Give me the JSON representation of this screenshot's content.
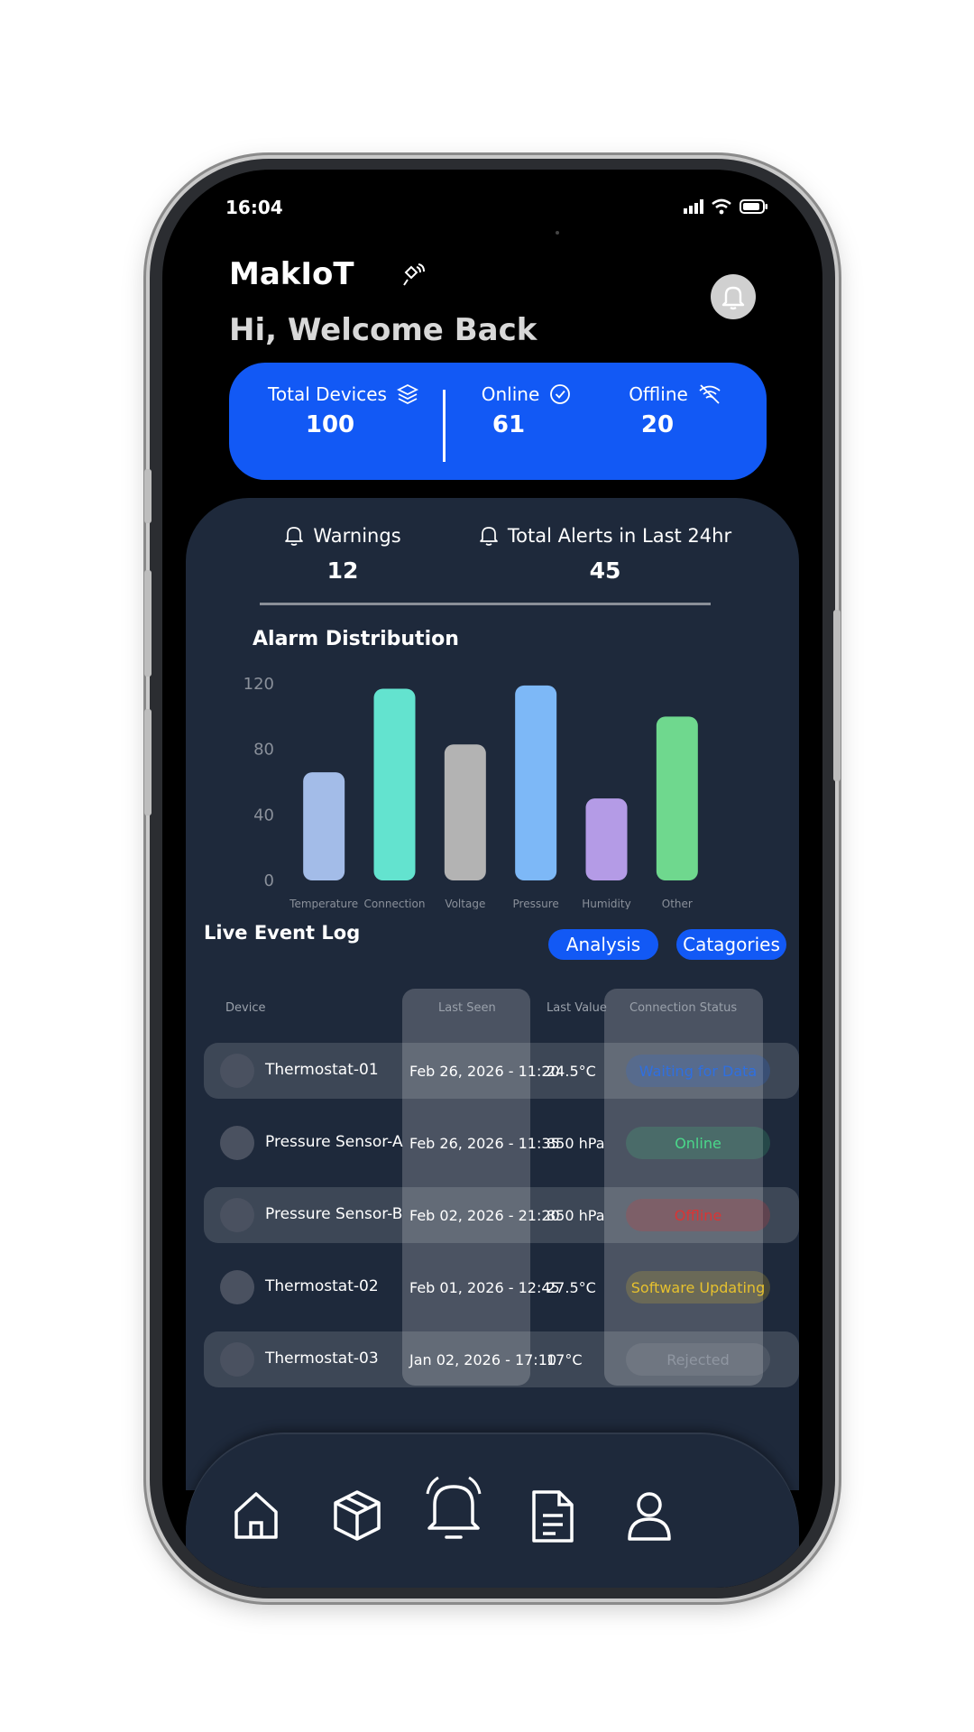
{
  "status_bar": {
    "time": "16:04"
  },
  "header": {
    "brand": "MakIoT",
    "greeting": "Hi, Welcome Back"
  },
  "summary": {
    "total_label": "Total Devices",
    "total_value": "100",
    "online_label": "Online",
    "online_value": "61",
    "offline_label": "Offline",
    "offline_value": "20"
  },
  "alerts": {
    "warnings_label": "Warnings",
    "warnings_value": "12",
    "total24_label": "Total Alerts in Last 24hr",
    "total24_value": "45"
  },
  "chart_data": {
    "type": "bar",
    "title": "Alarm Distribution",
    "categories": [
      "Temperature",
      "Connection",
      "Voltage",
      "Pressure",
      "Humidity",
      "Other"
    ],
    "values": [
      66,
      117,
      83,
      119,
      50,
      100
    ],
    "colors": [
      "#a3bce8",
      "#63e3cf",
      "#b3b3b3",
      "#7db8f7",
      "#b49be6",
      "#6fd88e"
    ],
    "ylim": [
      0,
      120
    ],
    "yticks": [
      0,
      40,
      80,
      120
    ],
    "grid": false
  },
  "event_log": {
    "title": "Live Event Log",
    "analysis_label": "Analysis",
    "categories_label": "Catagories",
    "columns": [
      "Device",
      "Last Seen",
      "Last Value",
      "Connection Status"
    ],
    "rows": [
      {
        "device": "Thermostat-01",
        "last_seen": "Feb 26, 2026 - 11:20",
        "last_value": "24.5°C",
        "status": "Waiting for Data"
      },
      {
        "device": "Pressure Sensor-A",
        "last_seen": "Feb 26, 2026 - 11:35",
        "last_value": "850 hPa",
        "status": "Online"
      },
      {
        "device": "Pressure Sensor-B",
        "last_seen": "Feb 02, 2026 - 21:20",
        "last_value": "850 hPa",
        "status": "Offline"
      },
      {
        "device": "Thermostat-02",
        "last_seen": "Feb 01, 2026 - 12:45",
        "last_value": "27.5°C",
        "status": "Software Updating"
      },
      {
        "device": "Thermostat-03",
        "last_seen": "Jan 02, 2026 - 17:10",
        "last_value": "17°C",
        "status": "Rejected"
      }
    ]
  },
  "nav": {
    "icons": [
      "home-icon",
      "box-icon",
      "bell-icon",
      "document-icon",
      "user-icon"
    ]
  },
  "colors": {
    "accent": "#1259f5",
    "panel": "#1e293b",
    "status_waiting": "#2f6fe0",
    "status_online": "#4ad88a",
    "status_offline": "#d93535",
    "status_updating": "#e6c12e",
    "status_rejected": "#8f96a1"
  }
}
